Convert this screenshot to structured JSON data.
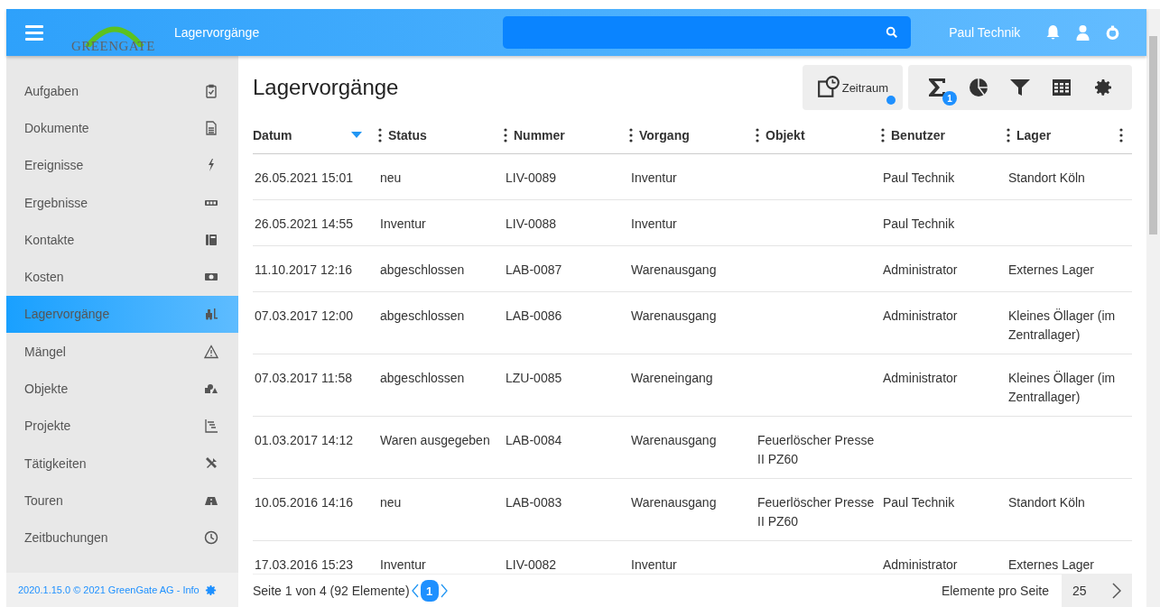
{
  "header": {
    "logo": "GREENGATE",
    "app_title": "Lagervorgänge",
    "user": "Paul Technik"
  },
  "sidebar": {
    "items": [
      {
        "label": "Aufgaben",
        "selected": false
      },
      {
        "label": "Dokumente",
        "selected": false
      },
      {
        "label": "Ereignisse",
        "selected": false
      },
      {
        "label": "Ergebnisse",
        "selected": false
      },
      {
        "label": "Kontakte",
        "selected": false
      },
      {
        "label": "Kosten",
        "selected": false
      },
      {
        "label": "Lagervorgänge",
        "selected": true
      },
      {
        "label": "Mängel",
        "selected": false
      },
      {
        "label": "Objekte",
        "selected": false
      },
      {
        "label": "Projekte",
        "selected": false
      },
      {
        "label": "Tätigkeiten",
        "selected": false
      },
      {
        "label": "Touren",
        "selected": false
      },
      {
        "label": "Zeitbuchungen",
        "selected": false
      }
    ],
    "footer": "2020.1.15.0 © 2021 GreenGate AG - Info"
  },
  "page_title": "Lagervorgänge",
  "toolbar": {
    "zeitraum": {
      "label": "Zeitraum",
      "active": true
    },
    "sum_badge": "1"
  },
  "table": {
    "columns": [
      {
        "label": "Datum",
        "sorted": true
      },
      {
        "label": "Status",
        "sorted": false
      },
      {
        "label": "Nummer",
        "sorted": false
      },
      {
        "label": "Vorgang",
        "sorted": false
      },
      {
        "label": "Objekt",
        "sorted": false
      },
      {
        "label": "Benutzer",
        "sorted": false
      },
      {
        "label": "Lager",
        "sorted": false
      }
    ],
    "rows": [
      [
        "26.05.2021 15:01",
        "neu",
        "LIV-0089",
        "Inventur",
        "",
        "Paul Technik",
        "Standort Köln"
      ],
      [
        "26.05.2021 14:55",
        "Inventur",
        "LIV-0088",
        "Inventur",
        "",
        "Paul Technik",
        ""
      ],
      [
        "11.10.2017 12:16",
        "abgeschlossen",
        "LAB-0087",
        "Warenausgang",
        "",
        "Administrator",
        "Externes Lager"
      ],
      [
        "07.03.2017 12:00",
        "abgeschlossen",
        "LAB-0086",
        "Warenausgang",
        "",
        "Administrator",
        "Kleines Öllager (im Zentrallager)"
      ],
      [
        "07.03.2017 11:58",
        "abgeschlossen",
        "LZU-0085",
        "Wareneingang",
        "",
        "Administrator",
        "Kleines Öllager (im Zentrallager)"
      ],
      [
        "01.03.2017 14:12",
        "Waren ausgegeben",
        "LAB-0084",
        "Warenausgang",
        "Feuerlöscher Presse II PZ60",
        "",
        ""
      ],
      [
        "10.05.2016 14:16",
        "neu",
        "LAB-0083",
        "Warenausgang",
        "Feuerlöscher Presse II PZ60",
        "Paul Technik",
        "Standort Köln"
      ],
      [
        "17.03.2016 15:23",
        "Inventur",
        "LIV-0082",
        "Inventur",
        "",
        "Administrator",
        "Externes Lager"
      ]
    ]
  },
  "pager": {
    "info": "Seite 1 von 4 (92 Elemente)",
    "page": "1",
    "per_page_label": "Elemente pro Seite",
    "per_page": "25"
  }
}
